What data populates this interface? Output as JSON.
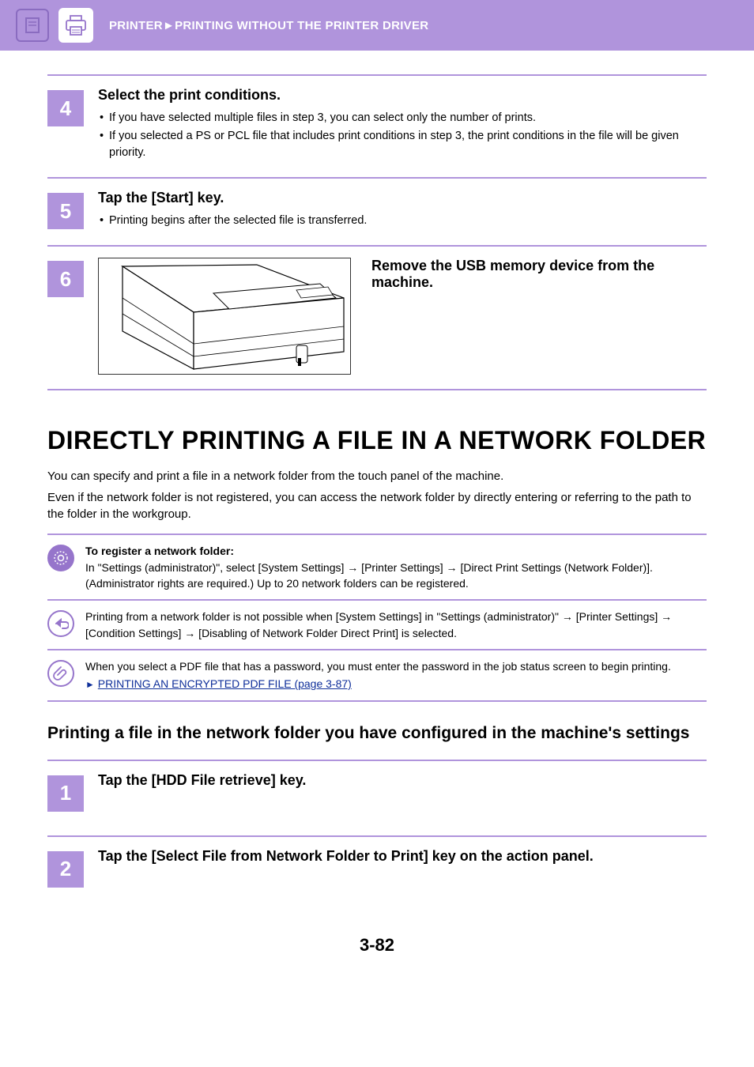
{
  "header": {
    "section": "PRINTER",
    "arrow": "►",
    "title": "PRINTING WITHOUT THE PRINTER DRIVER"
  },
  "steps_a": [
    {
      "num": "4",
      "title": "Select the print conditions.",
      "bullets": [
        "If you have selected multiple files in step 3, you can select only the number of prints.",
        "If you selected a PS or PCL file that includes print conditions in step 3, the print conditions in the file will be given priority."
      ]
    },
    {
      "num": "5",
      "title": "Tap the [Start] key.",
      "bullets": [
        "Printing begins after the selected file is transferred."
      ]
    },
    {
      "num": "6",
      "title": "Remove the USB memory device from the machine."
    }
  ],
  "main_heading": "DIRECTLY PRINTING A FILE IN A NETWORK FOLDER",
  "paragraphs": [
    "You can specify and print a file in a network folder from the touch panel of the machine.",
    "Even if the network folder is not registered, you can access the network folder by directly entering or referring to the path to the folder in the workgroup."
  ],
  "notes": {
    "register": {
      "title": "To register a network folder:",
      "body": "In \"Settings (administrator)\", select [System Settings] → [Printer Settings] →  [Direct Print Settings (Network Folder)]. (Administrator rights are required.) Up to 20 network folders can be registered."
    },
    "disabled": "Printing from a network folder is not possible when [System Settings] in \"Settings (administrator)\" → [Printer Settings] → [Condition Settings] → [Disabling of Network Folder Direct Print] is selected.",
    "pdf": "When you select a PDF file that has a password, you must enter the password in the job status screen to begin printing.",
    "link_text": "PRINTING AN ENCRYPTED PDF FILE (page 3-87)"
  },
  "sub_heading": "Printing a file in the network folder you have configured in the machine's settings",
  "steps_b": [
    {
      "num": "1",
      "title": "Tap the [HDD File retrieve] key."
    },
    {
      "num": "2",
      "title": "Tap the [Select File from Network Folder to Print] key on the action panel."
    }
  ],
  "page_number": "3-82"
}
